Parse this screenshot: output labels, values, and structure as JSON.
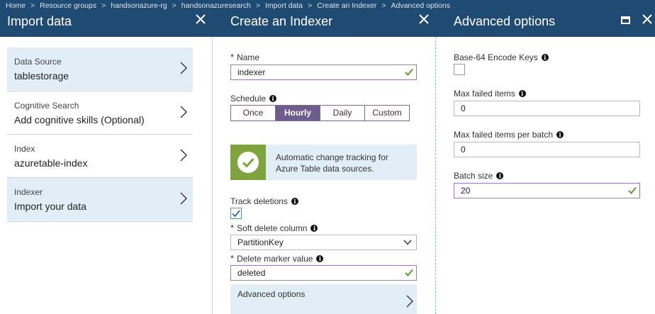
{
  "breadcrumb": {
    "items": [
      "Home",
      "Resource groups",
      "handsonazure-rg",
      "handsonazuresearch",
      "Import data",
      "Create an Indexer"
    ],
    "current": "Advanced options"
  },
  "import_blade": {
    "title": "Import data",
    "steps": [
      {
        "label": "Data Source",
        "value": "tablestorage"
      },
      {
        "label": "Cognitive Search",
        "value": "Add cognitive skills (Optional)"
      },
      {
        "label": "Index",
        "value": "azuretable-index"
      },
      {
        "label": "Indexer",
        "value": "Import your data"
      }
    ]
  },
  "indexer_blade": {
    "title": "Create an Indexer",
    "name_label": "Name",
    "name_value": "indexer",
    "schedule_label": "Schedule",
    "schedule_options": [
      "Once",
      "Hourly",
      "Daily",
      "Custom"
    ],
    "schedule_selected": "Hourly",
    "notice_text": "Automatic change tracking for Azure Table data sources.",
    "track_deletions_label": "Track deletions",
    "track_deletions_checked": true,
    "soft_delete_label": "Soft delete column",
    "soft_delete_value": "PartitionKey",
    "delete_marker_label": "Delete marker value",
    "delete_marker_value": "deleted",
    "advanced_label": "Advanced options"
  },
  "advanced_blade": {
    "title": "Advanced options",
    "base64_label": "Base-64 Encode Keys",
    "base64_checked": false,
    "max_failed_label": "Max failed items",
    "max_failed_value": "0",
    "max_failed_batch_label": "Max failed items per batch",
    "max_failed_batch_value": "0",
    "batch_size_label": "Batch size",
    "batch_size_value": "20"
  },
  "colors": {
    "header": "#1f4a72",
    "accent": "#6e5c8c",
    "selected_row": "#e1eef8",
    "success": "#7fa33d"
  },
  "icons": {
    "close": "close-icon",
    "maximize": "maximize-icon",
    "chevron": "chevron-right-icon",
    "info": "info-icon",
    "check": "checkmark-icon"
  }
}
